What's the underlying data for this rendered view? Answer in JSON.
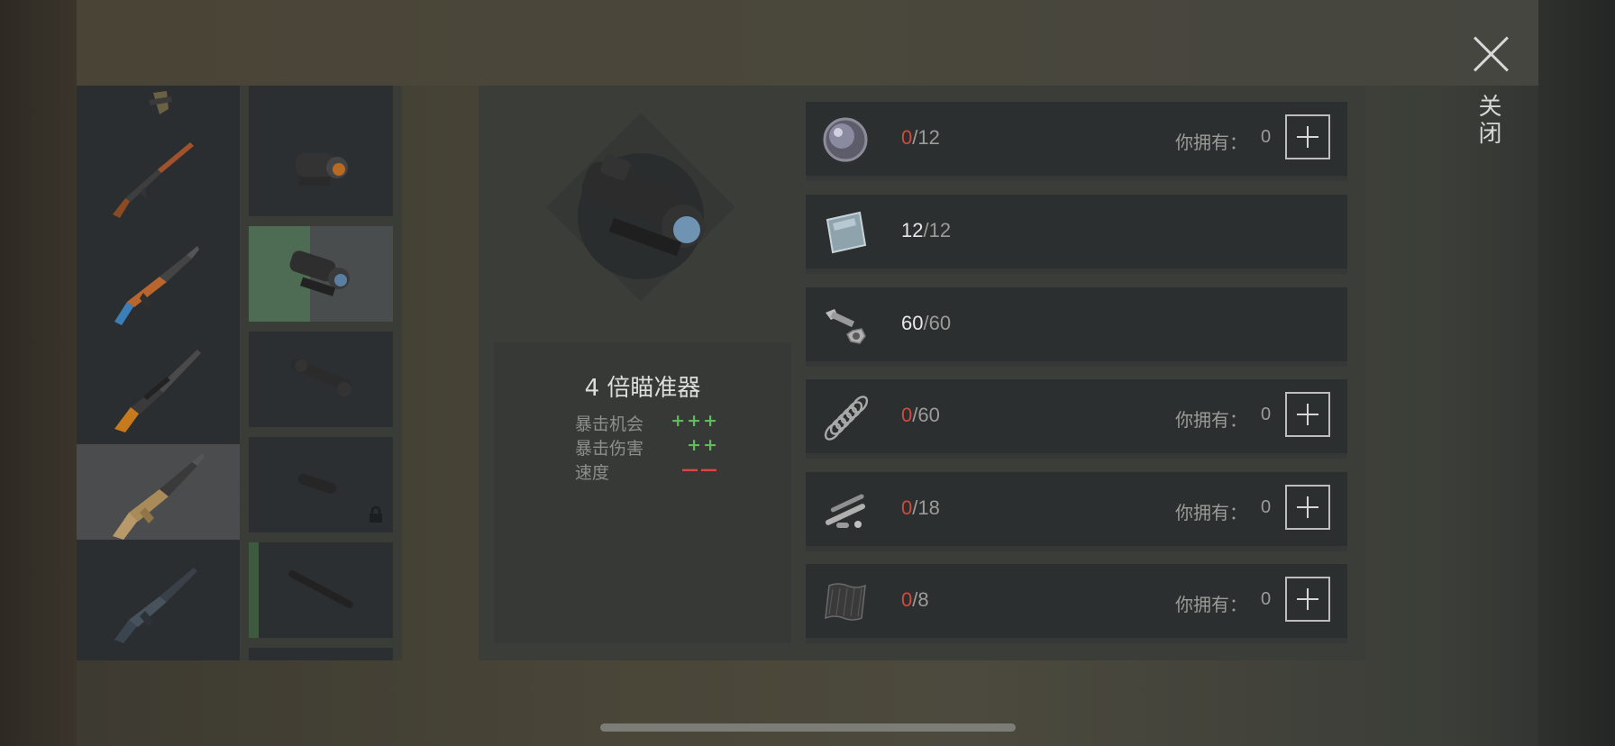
{
  "close_label": "关闭",
  "weapons": [
    {
      "name": "pistol-partial",
      "selected": false
    },
    {
      "name": "lever-action-shotgun",
      "selected": false
    },
    {
      "name": "ak-rifle",
      "selected": false
    },
    {
      "name": "sniper-rifle",
      "selected": false
    },
    {
      "name": "scar-rifle",
      "selected": true
    },
    {
      "name": "m16-rifle",
      "selected": false
    }
  ],
  "attachments": [
    {
      "name": "locked-top-partial",
      "locked": true
    },
    {
      "name": "red-dot-sight",
      "locked": false
    },
    {
      "name": "4x-scope",
      "active": true
    },
    {
      "name": "long-scope",
      "locked": false
    },
    {
      "name": "suppressor",
      "locked": true
    },
    {
      "name": "barrel",
      "equipped": true
    }
  ],
  "item": {
    "title": "4 倍瞄准器",
    "stats": [
      {
        "label": "暴击机会",
        "value": "+++",
        "type": "good"
      },
      {
        "label": "暴击伤害",
        "value": "++",
        "type": "good"
      },
      {
        "label": "速度",
        "value": "——",
        "type": "bad"
      }
    ]
  },
  "materials": [
    {
      "icon": "lens-icon",
      "have": "0",
      "need": "12",
      "enough": false,
      "owned_label": "你拥有：",
      "owned": "0"
    },
    {
      "icon": "glass-plate-icon",
      "have": "12",
      "need": "12",
      "enough": true
    },
    {
      "icon": "bolt-nut-icon",
      "have": "60",
      "need": "60",
      "enough": true
    },
    {
      "icon": "spring-icon",
      "have": "0",
      "need": "60",
      "enough": false,
      "owned_label": "你拥有：",
      "owned": "0"
    },
    {
      "icon": "gun-parts-icon",
      "have": "0",
      "need": "18",
      "enough": false,
      "owned_label": "你拥有：",
      "owned": "0"
    },
    {
      "icon": "rubber-sheet-icon",
      "have": "0",
      "need": "8",
      "enough": false,
      "owned_label": "你拥有：",
      "owned": "0"
    }
  ],
  "colors": {
    "red": "#d14a3e",
    "green": "#5ebd5a",
    "panel": "#3b3e38"
  }
}
